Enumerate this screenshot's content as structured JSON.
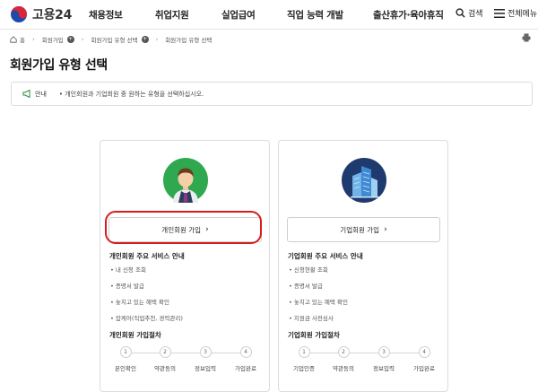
{
  "header": {
    "logo_text": "고용24",
    "menu": [
      "채용정보",
      "취업지원",
      "실업급여",
      "직업 능력 개발",
      "출산휴가·육아휴직"
    ],
    "search_label": "검색",
    "all_menu_label": "전체메뉴"
  },
  "breadcrumb": [
    "홈",
    "회원가입",
    "회원가입 유형 선택",
    "회원가입 유형 선택"
  ],
  "page_title": "회원가입 유형 선택",
  "notice": {
    "label": "안내",
    "text": "• 개인회원과 기업회원 중 원하는 유형을 선택하십시오."
  },
  "personal": {
    "join_label": "개인회원 가입",
    "service_title": "개인회원 주요 서비스 안내",
    "services": [
      "• 내 신청 조회",
      "• 증명서 발급",
      "• 놓치고 있는 혜택 확인",
      "• 잡케어(직업추천, 경력관리)"
    ],
    "process_title": "개인회원 가입절차",
    "steps": [
      {
        "num": "1",
        "label": "본인확인"
      },
      {
        "num": "2",
        "label": "약관동의"
      },
      {
        "num": "3",
        "label": "정보입력"
      },
      {
        "num": "4",
        "label": "가입완료"
      }
    ]
  },
  "company": {
    "join_label": "기업회원 가입",
    "service_title": "기업회원 주요 서비스 안내",
    "services": [
      "• 신청현황 조회",
      "• 증명서 발급",
      "• 놓치고 있는 혜택 확인",
      "• 지원금 사전심사"
    ],
    "process_title": "기업회원 가입절차",
    "steps": [
      {
        "num": "1",
        "label": "기업인증"
      },
      {
        "num": "2",
        "label": "약관동의"
      },
      {
        "num": "3",
        "label": "정보입력"
      },
      {
        "num": "4",
        "label": "가입완료"
      }
    ]
  },
  "colors": {
    "highlight": "#d61e1e",
    "avatar_bg": "#2fa84f",
    "building_bg": "#1f3a6e"
  }
}
